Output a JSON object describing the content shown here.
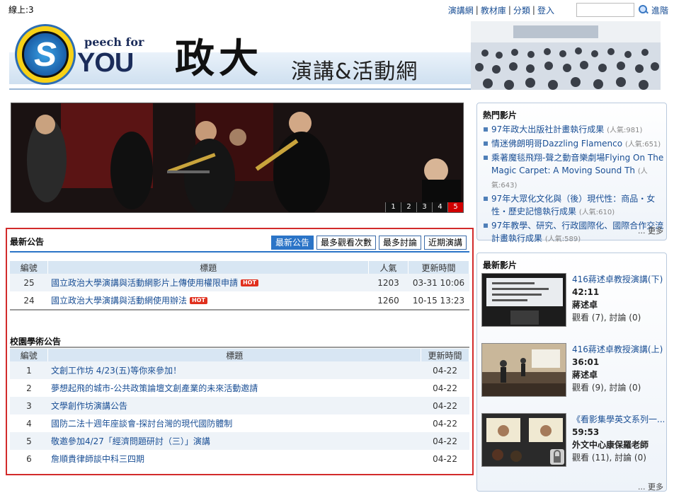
{
  "online": "線上:3",
  "nav": {
    "items": [
      "演講網",
      "教材庫",
      "分類",
      "登入"
    ],
    "search_placeholder": "",
    "advanced": "進階"
  },
  "logo": {
    "s": "S",
    "peech": "peech for",
    "you": "YOU",
    "cheng": "政大",
    "sub": "演講&活動網"
  },
  "slideshow": {
    "pages": [
      "1",
      "2",
      "3",
      "4",
      "5"
    ],
    "active_page": "5"
  },
  "announcements": {
    "title": "最新公告",
    "tabs": [
      "最新公告",
      "最多觀看次數",
      "最多討論",
      "近期演講"
    ],
    "headers": [
      "編號",
      "標題",
      "人氣",
      "更新時間"
    ],
    "hot_badge": "HOT",
    "rows": [
      {
        "id": "25",
        "title": "國立政治大學演講與活動網影片上傳使用權限申請",
        "views": "1203",
        "time": "03-31 10:06"
      },
      {
        "id": "24",
        "title": "國立政治大學演講與活動網使用辦法",
        "views": "1260",
        "time": "10-15 13:23"
      }
    ]
  },
  "campus": {
    "title": "校園學術公告",
    "headers": [
      "編號",
      "標題",
      "更新時間"
    ],
    "rows": [
      {
        "id": "1",
        "title": "文創工作坊 4/23(五)等你來參加！",
        "time": "04-22"
      },
      {
        "id": "2",
        "title": "夢想起飛的城市-公共政策論壇文創產業的未來活動邀請",
        "time": "04-22"
      },
      {
        "id": "3",
        "title": "文學創作坊演講公告",
        "time": "04-22"
      },
      {
        "id": "4",
        "title": "國防二法十週年座談會-探討台灣的現代國防體制",
        "time": "04-22"
      },
      {
        "id": "5",
        "title": "敬邀參加4/27「經濟問題研討（三）」演講",
        "time": "04-22"
      },
      {
        "id": "6",
        "title": "詹順貴律師談中科三四期",
        "time": "04-22"
      }
    ]
  },
  "hot_videos": {
    "title": "熱門影片",
    "more": "... 更多",
    "items": [
      {
        "title": "97年政大出版社計畫執行成果",
        "pop": "(人氣:981)"
      },
      {
        "title": "情迷佛朗明哥Dazzling Flamenco",
        "pop": "(人氣:651)"
      },
      {
        "title": "乘著魔毯飛翔-聲之動音樂劇場Flying On The Magic Carpet: A Moving Sound Th",
        "pop": "(人氣:643)"
      },
      {
        "title": "97年大眾化文化與（後）現代性：商品・女性・歷史記憶執行成果",
        "pop": "(人氣:610)"
      },
      {
        "title": "97年教學、研究、行政國際化、國際合作交流計畫執行成果",
        "pop": "(人氣:589)"
      }
    ]
  },
  "new_videos": {
    "title": "最新影片",
    "more": "... 更多",
    "items": [
      {
        "title": "416蔣述卓教授演講(下)",
        "duration": "42:11",
        "speaker": "蔣述卓",
        "stats": "觀看 (7), 討論 (0)"
      },
      {
        "title": "416蔣述卓教授演講(上)",
        "duration": "36:01",
        "speaker": "蔣述卓",
        "stats": "觀看 (9), 討論 (0)"
      },
      {
        "title": "《看影集學英文系列一...",
        "duration": "59:53",
        "speaker": "外文中心康保羅老師",
        "stats": "觀看 (11), 討論 (0)"
      }
    ]
  }
}
